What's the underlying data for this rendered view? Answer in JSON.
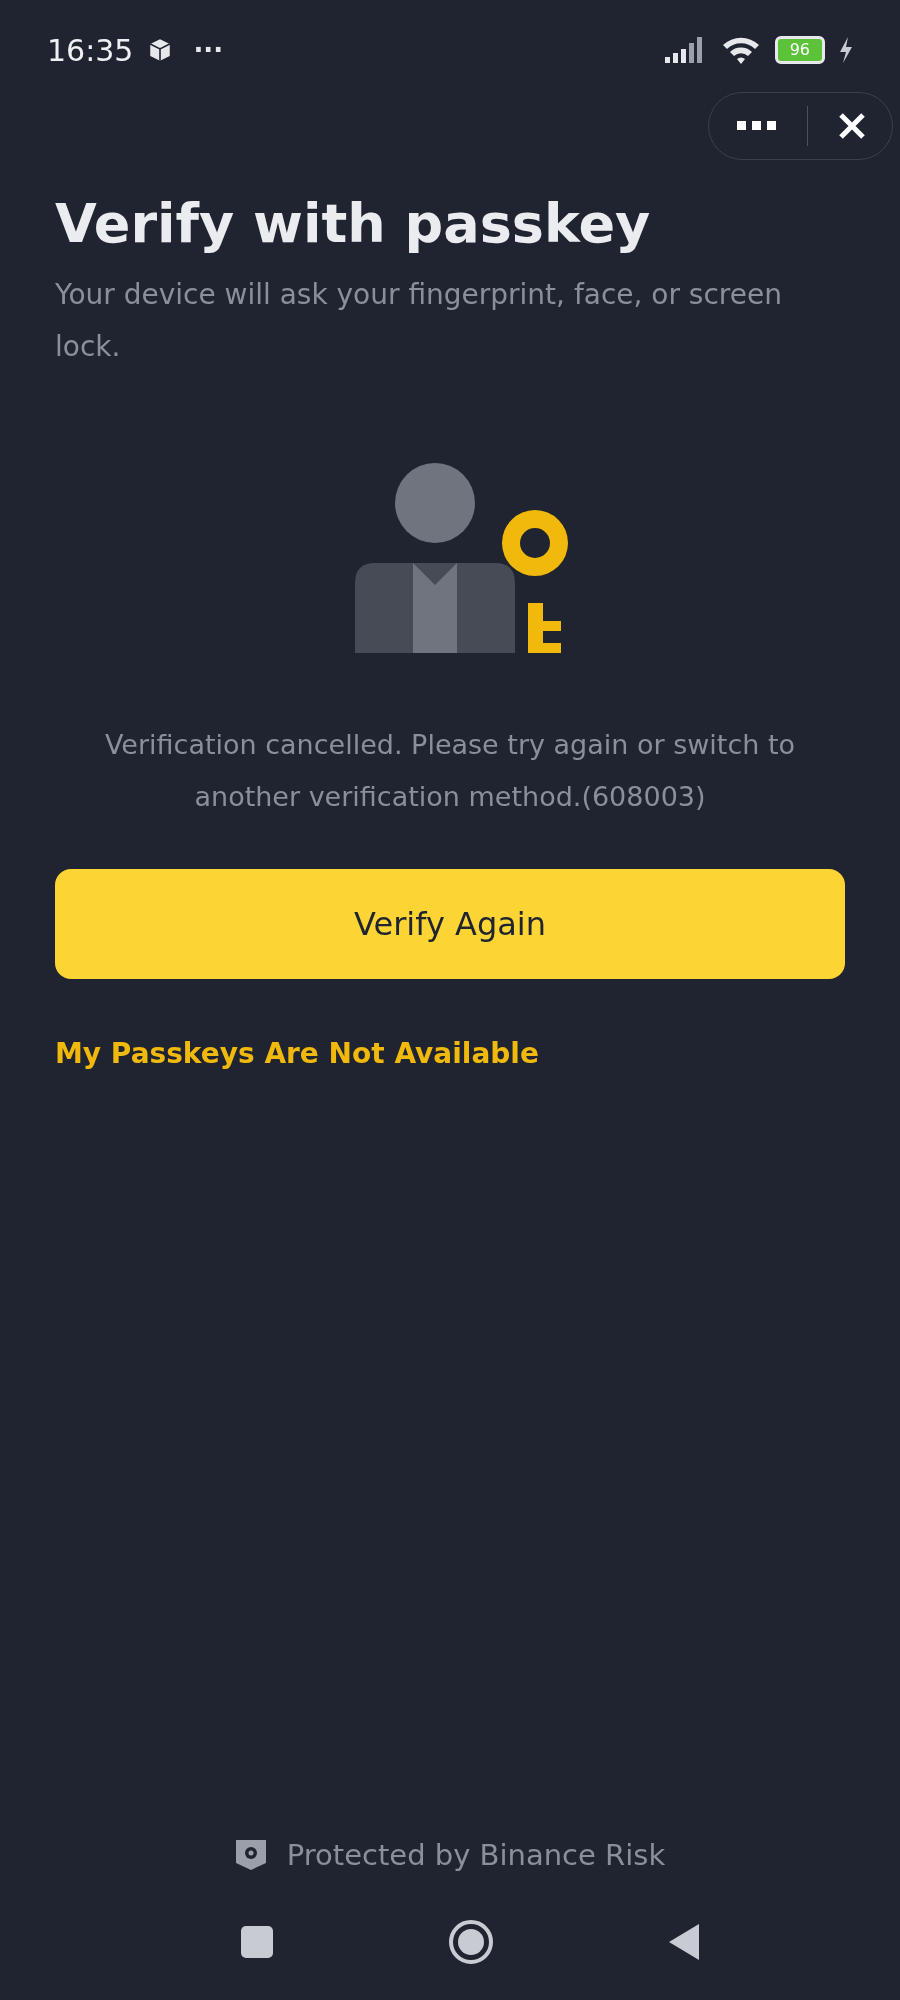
{
  "status_bar": {
    "time": "16:35",
    "notification_dots": "···",
    "battery": "96"
  },
  "title": "Verify with passkey",
  "subtitle": "Your device will ask your fingerprint, face, or screen lock.",
  "message": "Verification cancelled. Please try again or switch to another verification method.(608003)",
  "primary_button": "Verify Again",
  "link": "My Passkeys Are Not Available",
  "footer": "Protected by Binance Risk"
}
